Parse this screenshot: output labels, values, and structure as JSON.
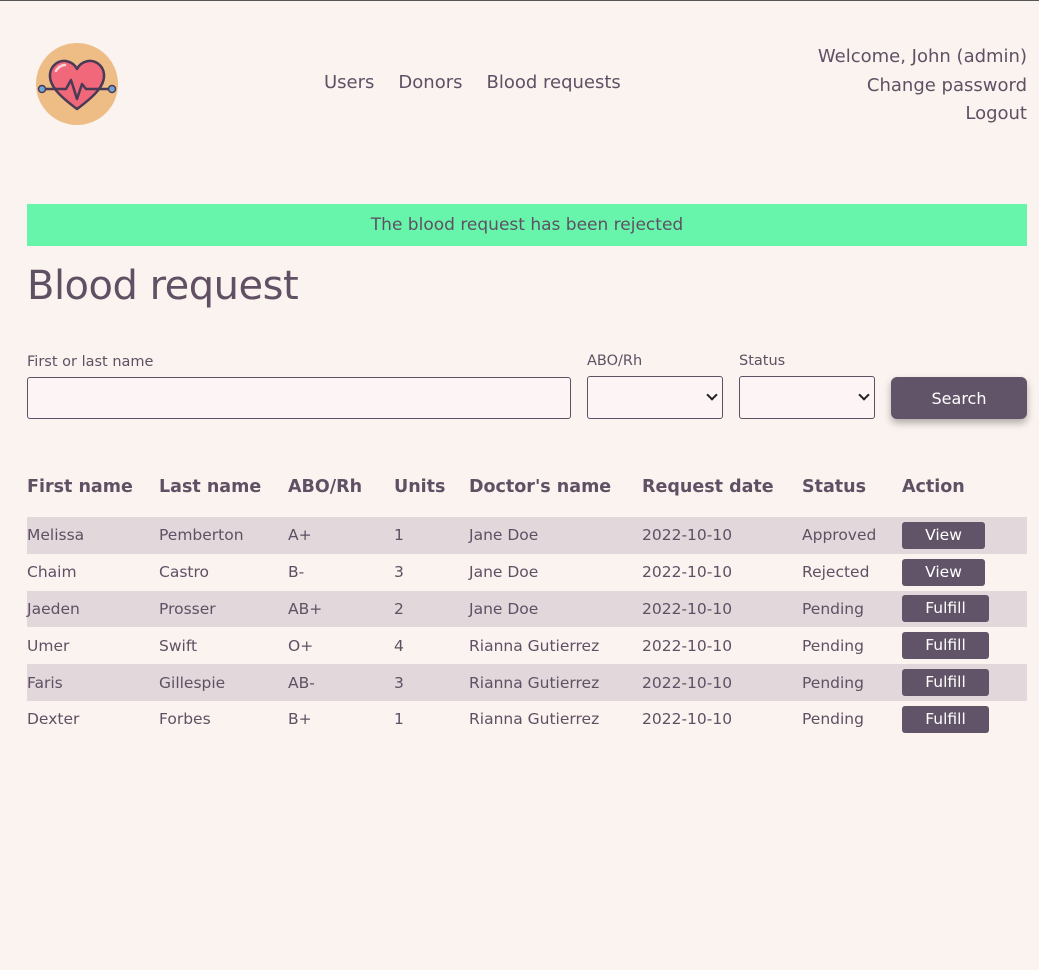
{
  "nav": {
    "items": [
      {
        "label": "Users"
      },
      {
        "label": "Donors"
      },
      {
        "label": "Blood requests"
      }
    ]
  },
  "user_menu": {
    "welcome": "Welcome, John (admin)",
    "change_password": "Change password",
    "logout": "Logout"
  },
  "alert": {
    "message": "The blood request has been rejected",
    "color": "#67f5ab"
  },
  "page_title": "Blood request",
  "filters": {
    "name_label": "First or last name",
    "name_value": "",
    "abo_label": "ABO/Rh",
    "abo_value": "",
    "status_label": "Status",
    "status_value": "",
    "search_label": "Search"
  },
  "table": {
    "headers": [
      "First name",
      "Last name",
      "ABO/Rh",
      "Units",
      "Doctor's name",
      "Request date",
      "Status",
      "Action"
    ],
    "rows": [
      {
        "first": "Melissa",
        "last": "Pemberton",
        "abo": "A+",
        "units": "1",
        "doctor": "Jane Doe",
        "date": "2022-10-10",
        "status": "Approved",
        "action": "View"
      },
      {
        "first": "Chaim",
        "last": "Castro",
        "abo": "B-",
        "units": "3",
        "doctor": "Jane Doe",
        "date": "2022-10-10",
        "status": "Rejected",
        "action": "View"
      },
      {
        "first": "Jaeden",
        "last": "Prosser",
        "abo": "AB+",
        "units": "2",
        "doctor": "Jane Doe",
        "date": "2022-10-10",
        "status": "Pending",
        "action": "Fulfill"
      },
      {
        "first": "Umer",
        "last": "Swift",
        "abo": "O+",
        "units": "4",
        "doctor": "Rianna Gutierrez",
        "date": "2022-10-10",
        "status": "Pending",
        "action": "Fulfill"
      },
      {
        "first": "Faris",
        "last": "Gillespie",
        "abo": "AB-",
        "units": "3",
        "doctor": "Rianna Gutierrez",
        "date": "2022-10-10",
        "status": "Pending",
        "action": "Fulfill"
      },
      {
        "first": "Dexter",
        "last": "Forbes",
        "abo": "B+",
        "units": "1",
        "doctor": "Rianna Gutierrez",
        "date": "2022-10-10",
        "status": "Pending",
        "action": "Fulfill"
      }
    ]
  },
  "icons": {
    "logo": "heart-pulse-icon"
  },
  "colors": {
    "background": "#fbf3ef",
    "text": "#5f5064",
    "button": "#625468",
    "row_stripe": "#e2d7da"
  }
}
